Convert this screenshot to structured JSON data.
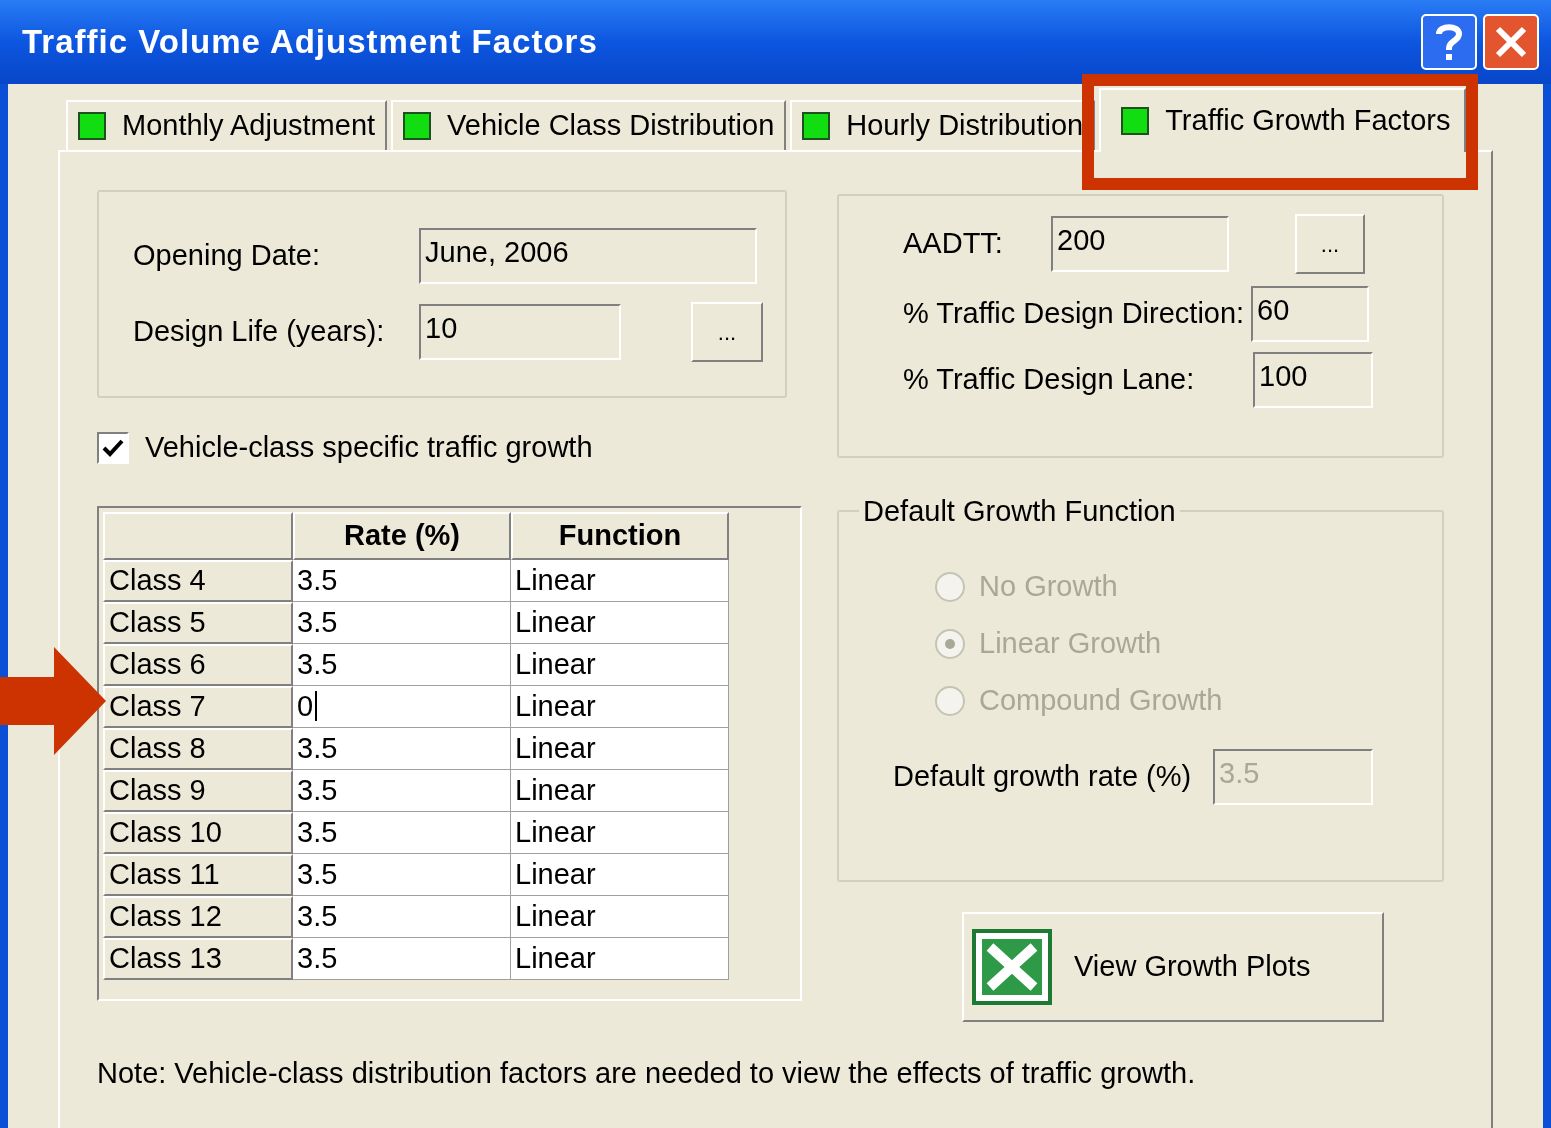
{
  "window": {
    "title": "Traffic Volume Adjustment Factors"
  },
  "tabs": [
    {
      "label": "Monthly Adjustment",
      "selected": false
    },
    {
      "label": "Vehicle Class Distribution",
      "selected": false
    },
    {
      "label": "Hourly Distribution",
      "selected": false
    },
    {
      "label": "Traffic Growth Factors",
      "selected": true
    }
  ],
  "opening_date": {
    "label": "Opening Date:",
    "value": "June, 2006"
  },
  "design_life": {
    "label": "Design Life (years):",
    "value": "10",
    "button": "..."
  },
  "aadtt": {
    "label": "AADTT:",
    "value": "200",
    "button": "..."
  },
  "direction": {
    "label": "% Traffic Design Direction:",
    "value": "60"
  },
  "lane": {
    "label": "% Traffic Design Lane:",
    "value": "100"
  },
  "class_growth": {
    "label": "Vehicle-class specific traffic growth",
    "checked": true
  },
  "table": {
    "columns": [
      "Rate (%)",
      "Function"
    ],
    "rows": [
      {
        "class": "Class 4",
        "rate": "3.5",
        "function": "Linear",
        "editing": false
      },
      {
        "class": "Class 5",
        "rate": "3.5",
        "function": "Linear",
        "editing": false
      },
      {
        "class": "Class 6",
        "rate": "3.5",
        "function": "Linear",
        "editing": false
      },
      {
        "class": "Class 7",
        "rate": "0",
        "function": "Linear",
        "editing": true
      },
      {
        "class": "Class 8",
        "rate": "3.5",
        "function": "Linear",
        "editing": false
      },
      {
        "class": "Class 9",
        "rate": "3.5",
        "function": "Linear",
        "editing": false
      },
      {
        "class": "Class 10",
        "rate": "3.5",
        "function": "Linear",
        "editing": false
      },
      {
        "class": "Class 11",
        "rate": "3.5",
        "function": "Linear",
        "editing": false
      },
      {
        "class": "Class 12",
        "rate": "3.5",
        "function": "Linear",
        "editing": false
      },
      {
        "class": "Class 13",
        "rate": "3.5",
        "function": "Linear",
        "editing": false
      }
    ]
  },
  "growth_function": {
    "title": "Default Growth Function",
    "disabled": true,
    "options": [
      {
        "label": "No Growth",
        "selected": false
      },
      {
        "label": "Linear Growth",
        "selected": true
      },
      {
        "label": "Compound Growth",
        "selected": false
      }
    ],
    "rate_label": "Default growth rate (%)",
    "rate_value": "3.5"
  },
  "view_plots": {
    "label": "View Growth Plots"
  },
  "note": "Note: Vehicle-class distribution factors are needed to view the effects of traffic growth."
}
